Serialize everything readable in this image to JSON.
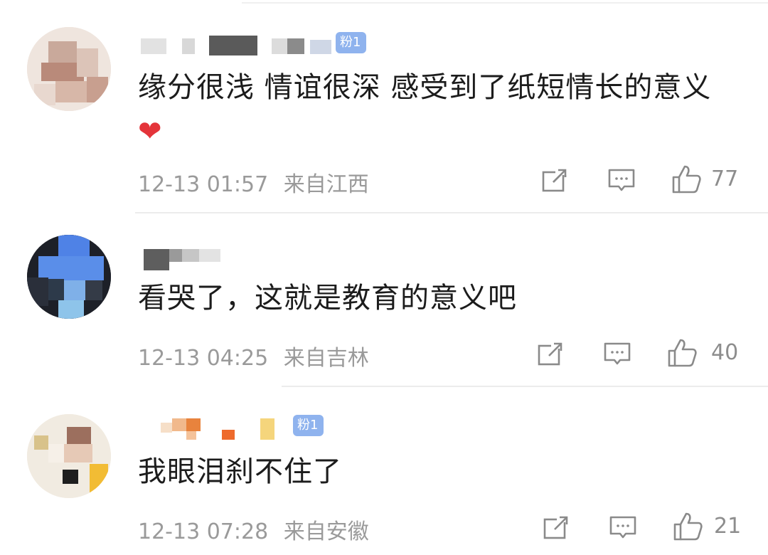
{
  "comments": [
    {
      "fan_badge": "粉1",
      "text": "缘分很浅 情谊很深  感受到了纸短情长的意义",
      "emoji": "❤️",
      "time": "12-13 01:57",
      "location": "来自江西",
      "likes": "77",
      "icons": [
        "share-icon",
        "comment-icon",
        "like-icon"
      ]
    },
    {
      "fan_badge": "",
      "text": "看哭了，这就是教育的意义吧",
      "time": "12-13 04:25",
      "location": "来自吉林",
      "likes": "40",
      "icons": [
        "share-icon",
        "comment-icon",
        "like-icon"
      ]
    },
    {
      "fan_badge": "粉1",
      "text": "我眼泪刹不住了",
      "time": "12-13 07:28",
      "location": "来自安徽",
      "likes": "21",
      "icons": [
        "share-icon",
        "comment-icon",
        "like-icon"
      ]
    }
  ],
  "colors": {
    "badge": "#8fb3ee",
    "meta_text": "#9a9a9a",
    "body_text": "#1c1c1c",
    "heart": "#e4343a"
  }
}
